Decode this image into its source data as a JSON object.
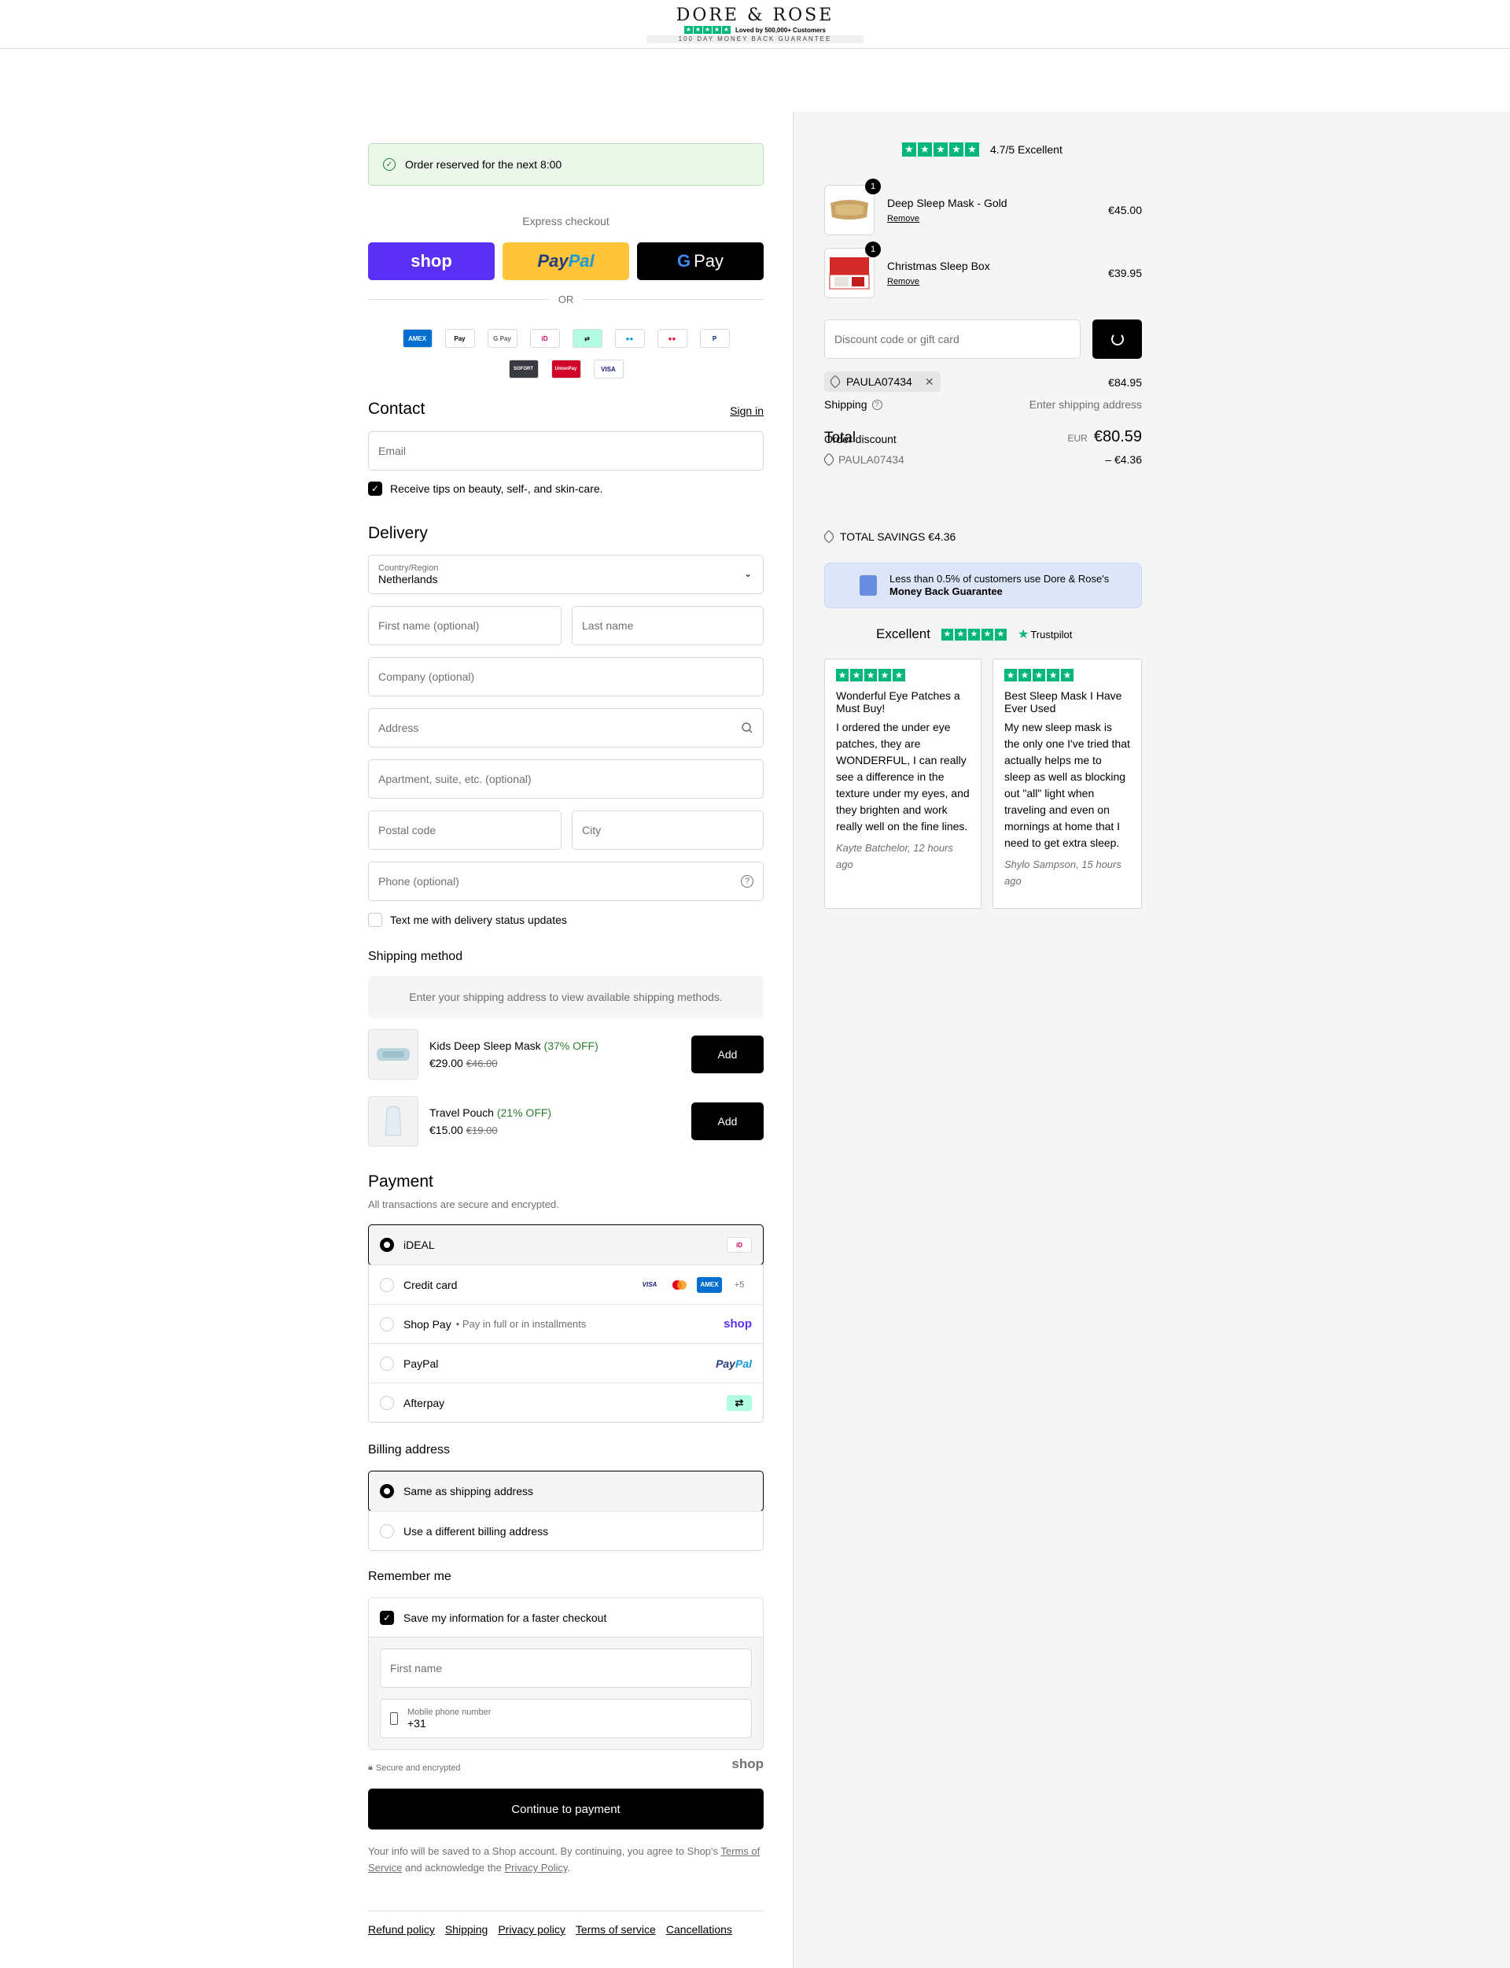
{
  "header": {
    "brand": "DORE & ROSE",
    "loved": "Loved by 500,000+ Customers",
    "guarantee": "100 DAY MONEY BACK GUARANTEE"
  },
  "reserve": {
    "text": "Order reserved for the next 8:00"
  },
  "express": {
    "label": "Express checkout",
    "shop": "shop",
    "paypal_a": "Pay",
    "paypal_b": "Pal",
    "gpay_g": "G",
    "gpay": "Pay",
    "or": "OR"
  },
  "payment_icons": [
    {
      "label": "AMEX",
      "icon": "amex-icon",
      "color": "#006fcf"
    },
    {
      "label": "Pay",
      "icon": "apple-pay-icon",
      "color": "#000000"
    },
    {
      "label": "G Pay",
      "icon": "google-pay-icon",
      "color": "#5f6368"
    },
    {
      "label": "iD",
      "icon": "ideal-icon",
      "color": "#cc0066"
    },
    {
      "label": "⇄",
      "icon": "afterpay-icon",
      "color": "#000000"
    },
    {
      "label": "●●",
      "icon": "maestro-icon",
      "color": "#0099df"
    },
    {
      "label": "●●",
      "icon": "mastercard-icon",
      "color": "#eb001b"
    },
    {
      "label": "P",
      "icon": "paypal-icon",
      "color": "#003087"
    },
    {
      "label": "SOFORT",
      "icon": "sofort-icon",
      "color": "#393a41"
    },
    {
      "label": "UnionPay",
      "icon": "unionpay-icon",
      "color": "#d10429"
    },
    {
      "label": "VISA",
      "icon": "visa-icon",
      "color": "#1a1f71"
    }
  ],
  "contact": {
    "title": "Contact",
    "signin": "Sign in",
    "email_placeholder": "Email",
    "tips": "Receive tips on beauty, self-, and skin-care."
  },
  "delivery": {
    "title": "Delivery",
    "country_label": "Country/Region",
    "country_value": "Netherlands",
    "first_name": "First name (optional)",
    "last_name": "Last name",
    "company": "Company (optional)",
    "address": "Address",
    "apartment": "Apartment, suite, etc. (optional)",
    "postal": "Postal code",
    "city": "City",
    "phone": "Phone (optional)",
    "text_me": "Text me with delivery status updates"
  },
  "shipping_method": {
    "title": "Shipping method",
    "message": "Enter your shipping address to view available shipping methods."
  },
  "upsells": [
    {
      "name": "Kids Deep Sleep Mask",
      "off": "(37% OFF)",
      "price": "€29.00",
      "old": "€46.00",
      "add": "Add"
    },
    {
      "name": "Travel Pouch",
      "off": "(21% OFF)",
      "price": "€15.00",
      "old": "€19.00",
      "add": "Add"
    }
  ],
  "payment": {
    "title": "Payment",
    "subtitle": "All transactions are secure and encrypted.",
    "options": [
      {
        "label": "iDEAL",
        "selected": true
      },
      {
        "label": "Credit card",
        "more": "+5"
      },
      {
        "label": "Shop Pay",
        "sub": "• Pay in full or in installments",
        "logo": "shop"
      },
      {
        "label": "PayPal",
        "logo_a": "Pay",
        "logo_b": "Pal"
      },
      {
        "label": "Afterpay"
      }
    ],
    "card_visa": "VISA",
    "card_amex": "AMEX",
    "ideal_mark": "iD"
  },
  "billing": {
    "title": "Billing address",
    "same": "Same as shipping address",
    "different": "Use a different billing address"
  },
  "remember": {
    "title": "Remember me",
    "save": "Save my information for a faster checkout",
    "first_name": "First name",
    "mobile_label": "Mobile phone number",
    "mobile_value": "+31",
    "secure": "Secure and encrypted",
    "shop": "shop"
  },
  "continue": "Continue to payment",
  "disclaimer": {
    "a": "Your info will be saved to a Shop account. By continuing, you agree to Shop's ",
    "tos": "Terms of Service",
    "b": " and acknowledge the ",
    "privacy": "Privacy Policy",
    "c": "."
  },
  "footer": [
    "Refund policy",
    "Shipping",
    "Privacy policy",
    "Terms of service",
    "Cancellations"
  ],
  "summary": {
    "rating": "4.7/5 Excellent",
    "items": [
      {
        "name": "Deep Sleep Mask - Gold",
        "remove": "Remove",
        "price": "€45.00",
        "qty": "1"
      },
      {
        "name": "Christmas Sleep Box",
        "remove": "Remove",
        "price": "€39.95",
        "qty": "1"
      }
    ],
    "discount_placeholder": "Discount code or gift card",
    "code": "PAULA07434",
    "subtotal": "€84.95",
    "shipping_label": "Shipping",
    "shipping_value": "Enter shipping address",
    "total_label": "Total",
    "order_discount": "Order discount",
    "currency": "EUR",
    "total": "€80.59",
    "discount_value": "– €4.36",
    "savings": "TOTAL SAVINGS €4.36",
    "mbg_a": "Less than 0.5% of customers use Dore & Rose's",
    "mbg_b": "Money Back Guarantee",
    "excellent": "Excellent",
    "trustpilot": "Trustpilot",
    "reviews": [
      {
        "title": "Wonderful Eye Patches a Must Buy!",
        "body": "I ordered the under eye patches, they are WONDERFUL, I can really see a difference in the texture under my eyes, and they brighten and work really well on the fine lines.",
        "author": "Kayte Batchelor, 12 hours ago"
      },
      {
        "title": "Best Sleep Mask I Have Ever Used",
        "body": "My new sleep mask is the only one I've tried that actually helps me to sleep as well as blocking out \"all\" light when traveling and even on mornings at home that I need to get extra sleep.",
        "author": "Shylo Sampson, 15 hours ago"
      }
    ]
  },
  "colors": {
    "accent": "#000000",
    "shop": "#5a31f4",
    "paypal": "#ffc439",
    "trustpilot": "#00b67a"
  }
}
